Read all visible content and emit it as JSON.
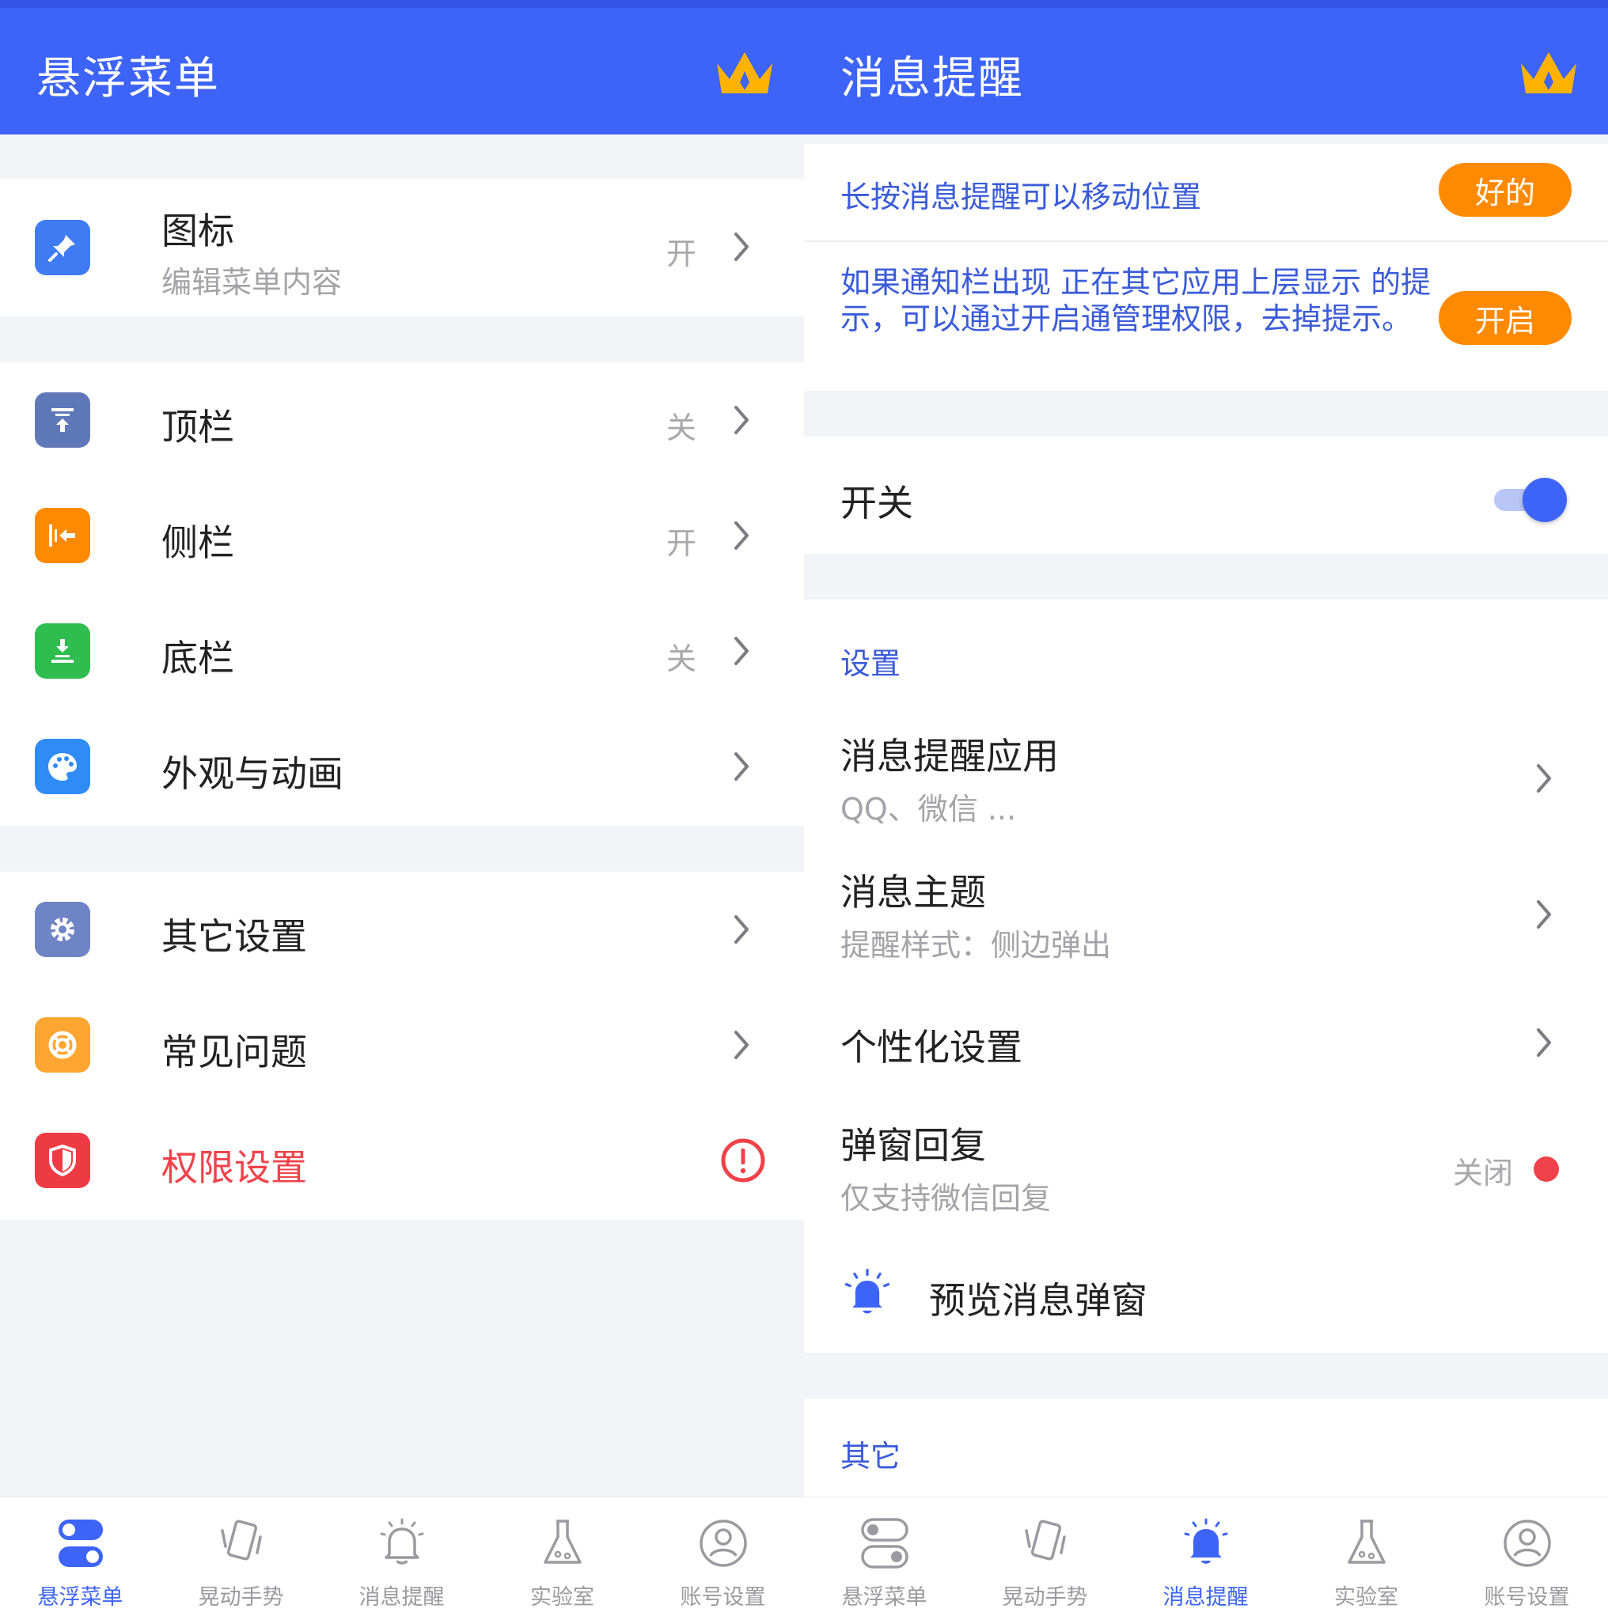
{
  "left": {
    "header": {
      "title": "悬浮菜单"
    },
    "icon_row": {
      "label": "图标",
      "sub": "编辑菜单内容",
      "status": "开"
    },
    "bars": [
      {
        "label": "顶栏",
        "status": "关"
      },
      {
        "label": "侧栏",
        "status": "开"
      },
      {
        "label": "底栏",
        "status": "关"
      },
      {
        "label": "外观与动画",
        "status": ""
      }
    ],
    "misc": [
      {
        "label": "其它设置"
      },
      {
        "label": "常见问题"
      },
      {
        "label": "权限设置"
      }
    ],
    "colors": {
      "permission": "#f0424a"
    }
  },
  "right": {
    "header": {
      "title": "消息提醒"
    },
    "tips": [
      {
        "text": "长按消息提醒可以移动位置",
        "button": "好的"
      },
      {
        "text": "如果通知栏出现 正在其它应用上层显示 的提示，可以通过开启通管理权限，去掉提示。",
        "button": "开启"
      }
    ],
    "switch": {
      "label": "开关",
      "on": true
    },
    "settings": {
      "section": "设置",
      "items": [
        {
          "label": "消息提醒应用",
          "sub": "QQ、微信 ..."
        },
        {
          "label": "消息主题",
          "sub": "提醒样式：侧边弹出"
        },
        {
          "label": "个性化设置",
          "sub": ""
        },
        {
          "label": "弹窗回复",
          "sub": "仅支持微信回复",
          "status": "关闭"
        }
      ],
      "preview": "预览消息弹窗"
    },
    "other": {
      "section": "其它"
    }
  },
  "tabs": [
    "悬浮菜单",
    "晃动手势",
    "消息提醒",
    "实验室",
    "账号设置"
  ],
  "active_tab": {
    "left": "悬浮菜单",
    "right": "消息提醒"
  },
  "colors": {
    "header": "#3d64f6",
    "accent": "#ff8a00",
    "text_blue": "#3a5bd9",
    "red_dot": "#f0424a"
  }
}
